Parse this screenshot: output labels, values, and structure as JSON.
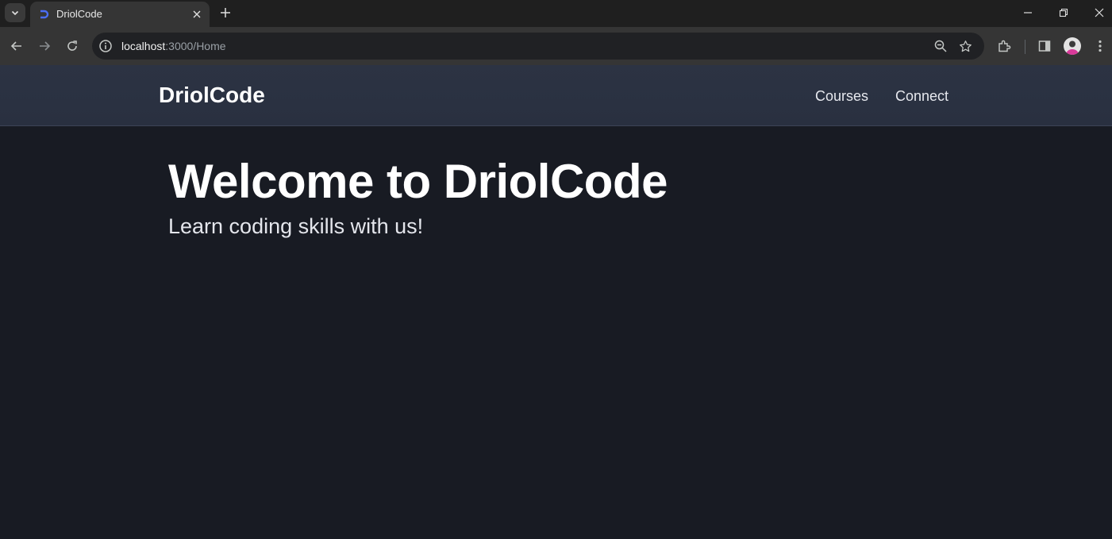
{
  "browser": {
    "tab_title": "DriolCode",
    "url_host": "localhost",
    "url_rest": ":3000/Home"
  },
  "page": {
    "brand": "DriolCode",
    "nav": [
      {
        "label": "Courses"
      },
      {
        "label": "Connect"
      }
    ],
    "hero_title": "Welcome to DriolCode",
    "hero_subtitle": "Learn coding skills with us!"
  },
  "colors": {
    "navbar_bg": "#2c3343",
    "page_bg": "#181b23",
    "favicon": "#4c6ef5"
  },
  "icons": [
    "tab-search-icon",
    "favicon-icon",
    "close-icon",
    "plus-icon",
    "minimize-icon",
    "restore-icon",
    "window-close-icon",
    "back-icon",
    "forward-icon",
    "reload-icon",
    "info-icon",
    "zoom-icon",
    "star-icon",
    "extensions-icon",
    "side-panel-icon",
    "profile-avatar",
    "more-icon"
  ]
}
